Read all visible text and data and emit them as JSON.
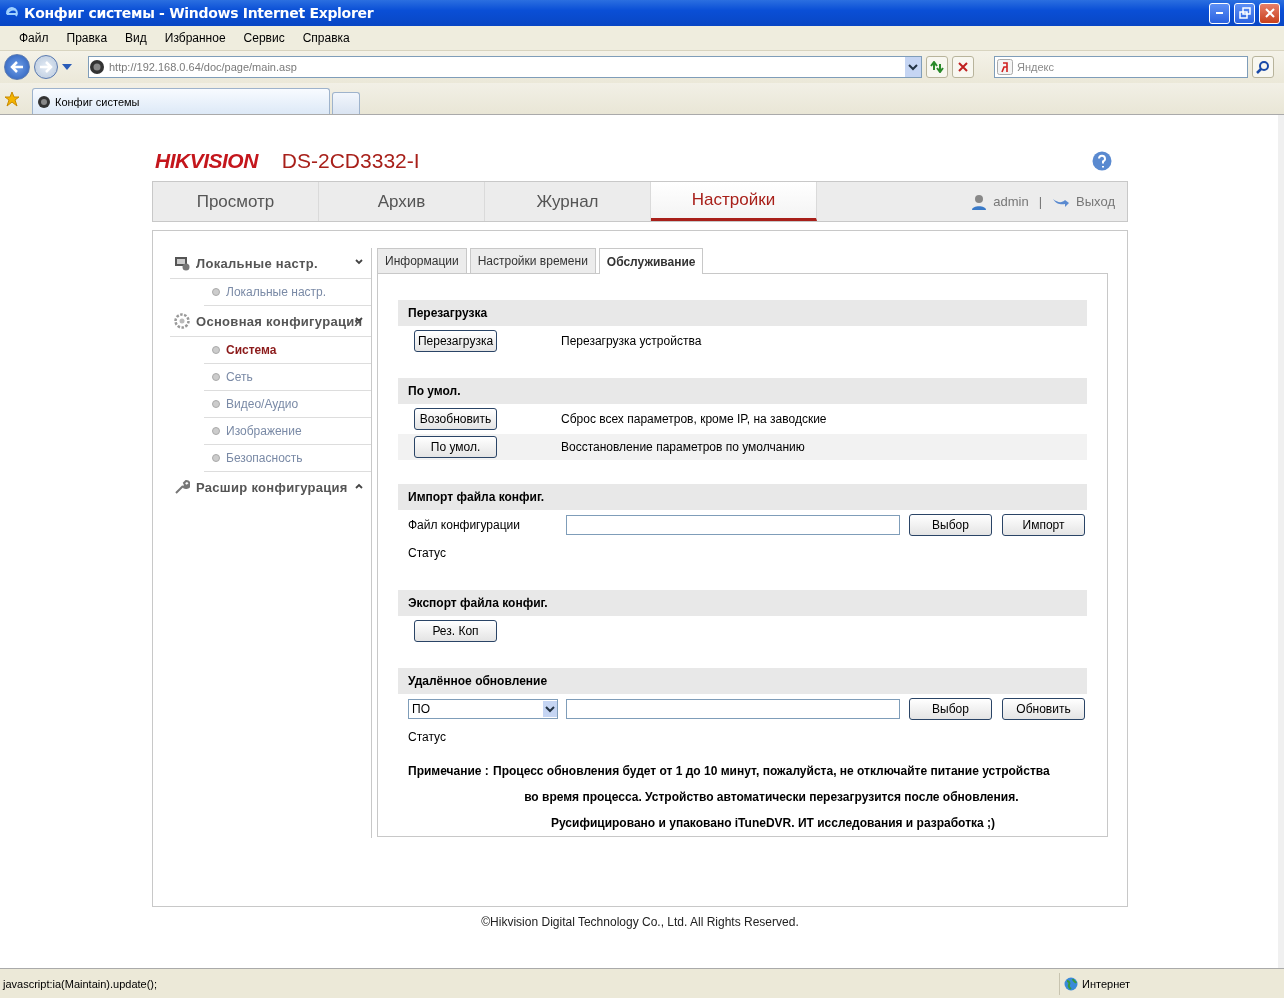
{
  "window": {
    "title": "Конфиг системы - Windows Internet Explorer"
  },
  "menu_bar": [
    "Файл",
    "Правка",
    "Вид",
    "Избранное",
    "Сервис",
    "Справка"
  ],
  "address_bar": {
    "url": "http://192.168.0.64/doc/page/main.asp"
  },
  "search": {
    "placeholder": "Яндекс"
  },
  "browser_tabs": [
    {
      "label": "Конфиг системы",
      "selected": true
    }
  ],
  "page": {
    "brand": "HIKVISION",
    "model": "DS-2CD3332-I",
    "nav_tabs": [
      {
        "label": "Просмотр",
        "selected": false
      },
      {
        "label": "Архив",
        "selected": false
      },
      {
        "label": "Журнал",
        "selected": false
      },
      {
        "label": "Настройки",
        "selected": true
      }
    ],
    "user": "admin",
    "separator": "|",
    "logout": "Выход",
    "sidebar": [
      {
        "title": "Локальные настр.",
        "expanded": true,
        "items": [
          {
            "label": "Локальные настр.",
            "selected": false
          }
        ]
      },
      {
        "title": "Основная конфигурация",
        "expanded": true,
        "items": [
          {
            "label": "Система",
            "selected": true
          },
          {
            "label": "Сеть",
            "selected": false
          },
          {
            "label": "Видео/Аудио",
            "selected": false
          },
          {
            "label": "Изображение",
            "selected": false
          },
          {
            "label": "Безопасность",
            "selected": false
          }
        ]
      },
      {
        "title": "Расшир конфигурация",
        "expanded": false
      }
    ],
    "sub_tabs": [
      {
        "label": "Информации",
        "selected": false
      },
      {
        "label": "Настройки времени",
        "selected": false
      },
      {
        "label": "Обслуживание",
        "selected": true
      }
    ],
    "sections": [
      {
        "title": "Перезагрузка",
        "rows": [
          {
            "kind": "action",
            "button": "Перезагрузка",
            "description": "Перезагрузка устройства",
            "highlighted": false
          }
        ]
      },
      {
        "title": "По умол.",
        "rows": [
          {
            "kind": "action",
            "button": "Возобновить",
            "description": "Сброс всех параметров, кроме IP, на заводские",
            "highlighted": false
          },
          {
            "kind": "action",
            "button": "По умол.",
            "description": "Восстановление параметров по умолчанию",
            "highlighted": true
          }
        ]
      },
      {
        "title": "Импорт файла конфиг.",
        "rows": [
          {
            "kind": "file",
            "label": "Файл конфигурации",
            "buttons": [
              "Выбор",
              "Импорт"
            ]
          },
          {
            "kind": "status",
            "label": "Статус"
          }
        ]
      },
      {
        "title": "Экспорт файла конфиг.",
        "rows": [
          {
            "kind": "button",
            "button": "Рез. Коп"
          }
        ]
      },
      {
        "title": "Удалённое обновление",
        "rows": [
          {
            "kind": "select_file",
            "select": "ПО",
            "buttons": [
              "Выбор",
              "Обновить"
            ]
          },
          {
            "kind": "status",
            "label": "Статус"
          },
          {
            "kind": "note",
            "label": "Примечание :",
            "lines": [
              "Процесс обновления будет от 1 до 10 минут, пожалуйста, не отключайте питание устройства",
              "во время процесса. Устройство автоматически перезагрузится после обновления.",
              " Русифицировано и упаковано iTuneDVR. ИТ исследования и разработка ;)"
            ]
          }
        ]
      }
    ],
    "copyright": "©Hikvision Digital Technology Co., Ltd. All Rights Reserved."
  },
  "status_bar": {
    "text": "javascript:ia(Maintain).update();",
    "zone": "Интернет"
  }
}
